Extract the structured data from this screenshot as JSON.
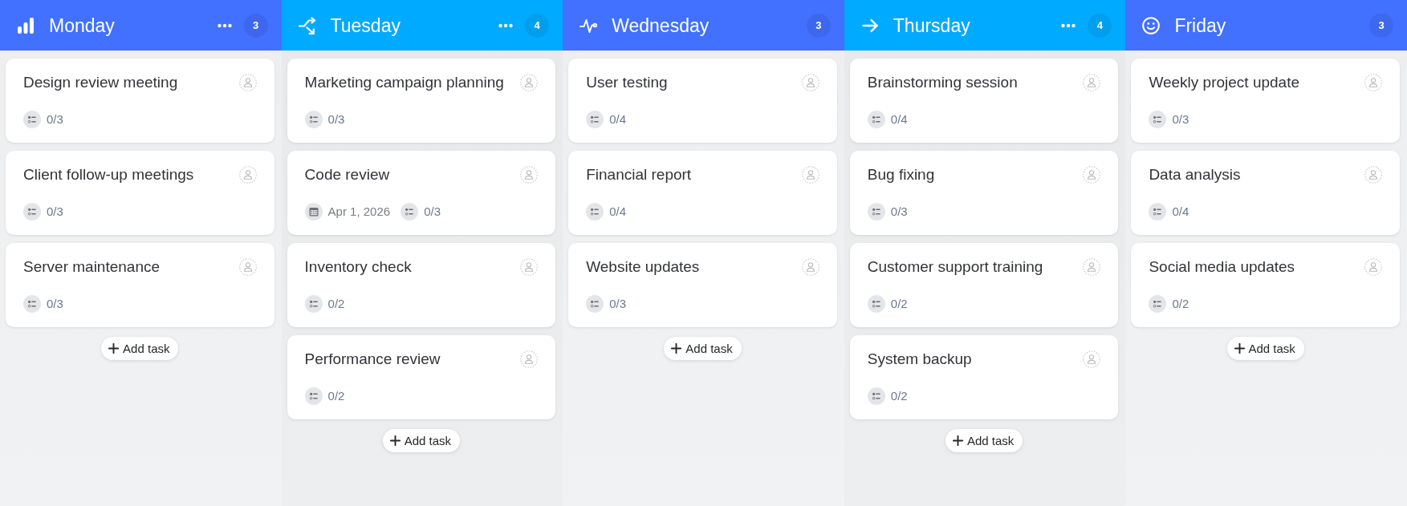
{
  "columns": [
    {
      "title": "Monday",
      "color": "#4270ff",
      "menu": true,
      "count": "3",
      "cards": [
        {
          "title": "Design review meeting",
          "checklist": "0/3"
        },
        {
          "title": "Client follow-up meetings",
          "checklist": "0/3"
        },
        {
          "title": "Server maintenance",
          "checklist": "0/3"
        }
      ],
      "add_button": "Add task"
    },
    {
      "title": "Tuesday",
      "color": "#00aaff",
      "menu": true,
      "count": "4",
      "cards": [
        {
          "title": "Marketing campaign planning",
          "checklist": "0/3"
        },
        {
          "title": "Code review",
          "due_date": "Apr 1, 2026",
          "checklist": "0/3"
        },
        {
          "title": "Inventory check",
          "checklist": "0/2"
        },
        {
          "title": "Performance review",
          "checklist": "0/2"
        }
      ],
      "add_button": "Add task"
    },
    {
      "title": "Wednesday",
      "color": "#4270ff",
      "menu": false,
      "count": "3",
      "cards": [
        {
          "title": "User testing",
          "checklist": "0/4"
        },
        {
          "title": "Financial report",
          "checklist": "0/4"
        },
        {
          "title": "Website updates",
          "checklist": "0/3"
        }
      ],
      "add_button": "Add task"
    },
    {
      "title": "Thursday",
      "color": "#00aaff",
      "menu": true,
      "count": "4",
      "cards": [
        {
          "title": "Brainstorming session",
          "checklist": "0/4"
        },
        {
          "title": "Bug fixing",
          "checklist": "0/3"
        },
        {
          "title": "Customer support training",
          "checklist": "0/2"
        },
        {
          "title": "System backup",
          "checklist": "0/2"
        }
      ],
      "add_button": "Add task"
    },
    {
      "title": "Friday",
      "color": "#4270ff",
      "menu": false,
      "count": "3",
      "cards": [
        {
          "title": "Weekly project update",
          "checklist": "0/3"
        },
        {
          "title": "Data analysis",
          "checklist": "0/4"
        },
        {
          "title": "Social media updates",
          "checklist": "0/2"
        }
      ],
      "add_button": "Add task"
    }
  ]
}
